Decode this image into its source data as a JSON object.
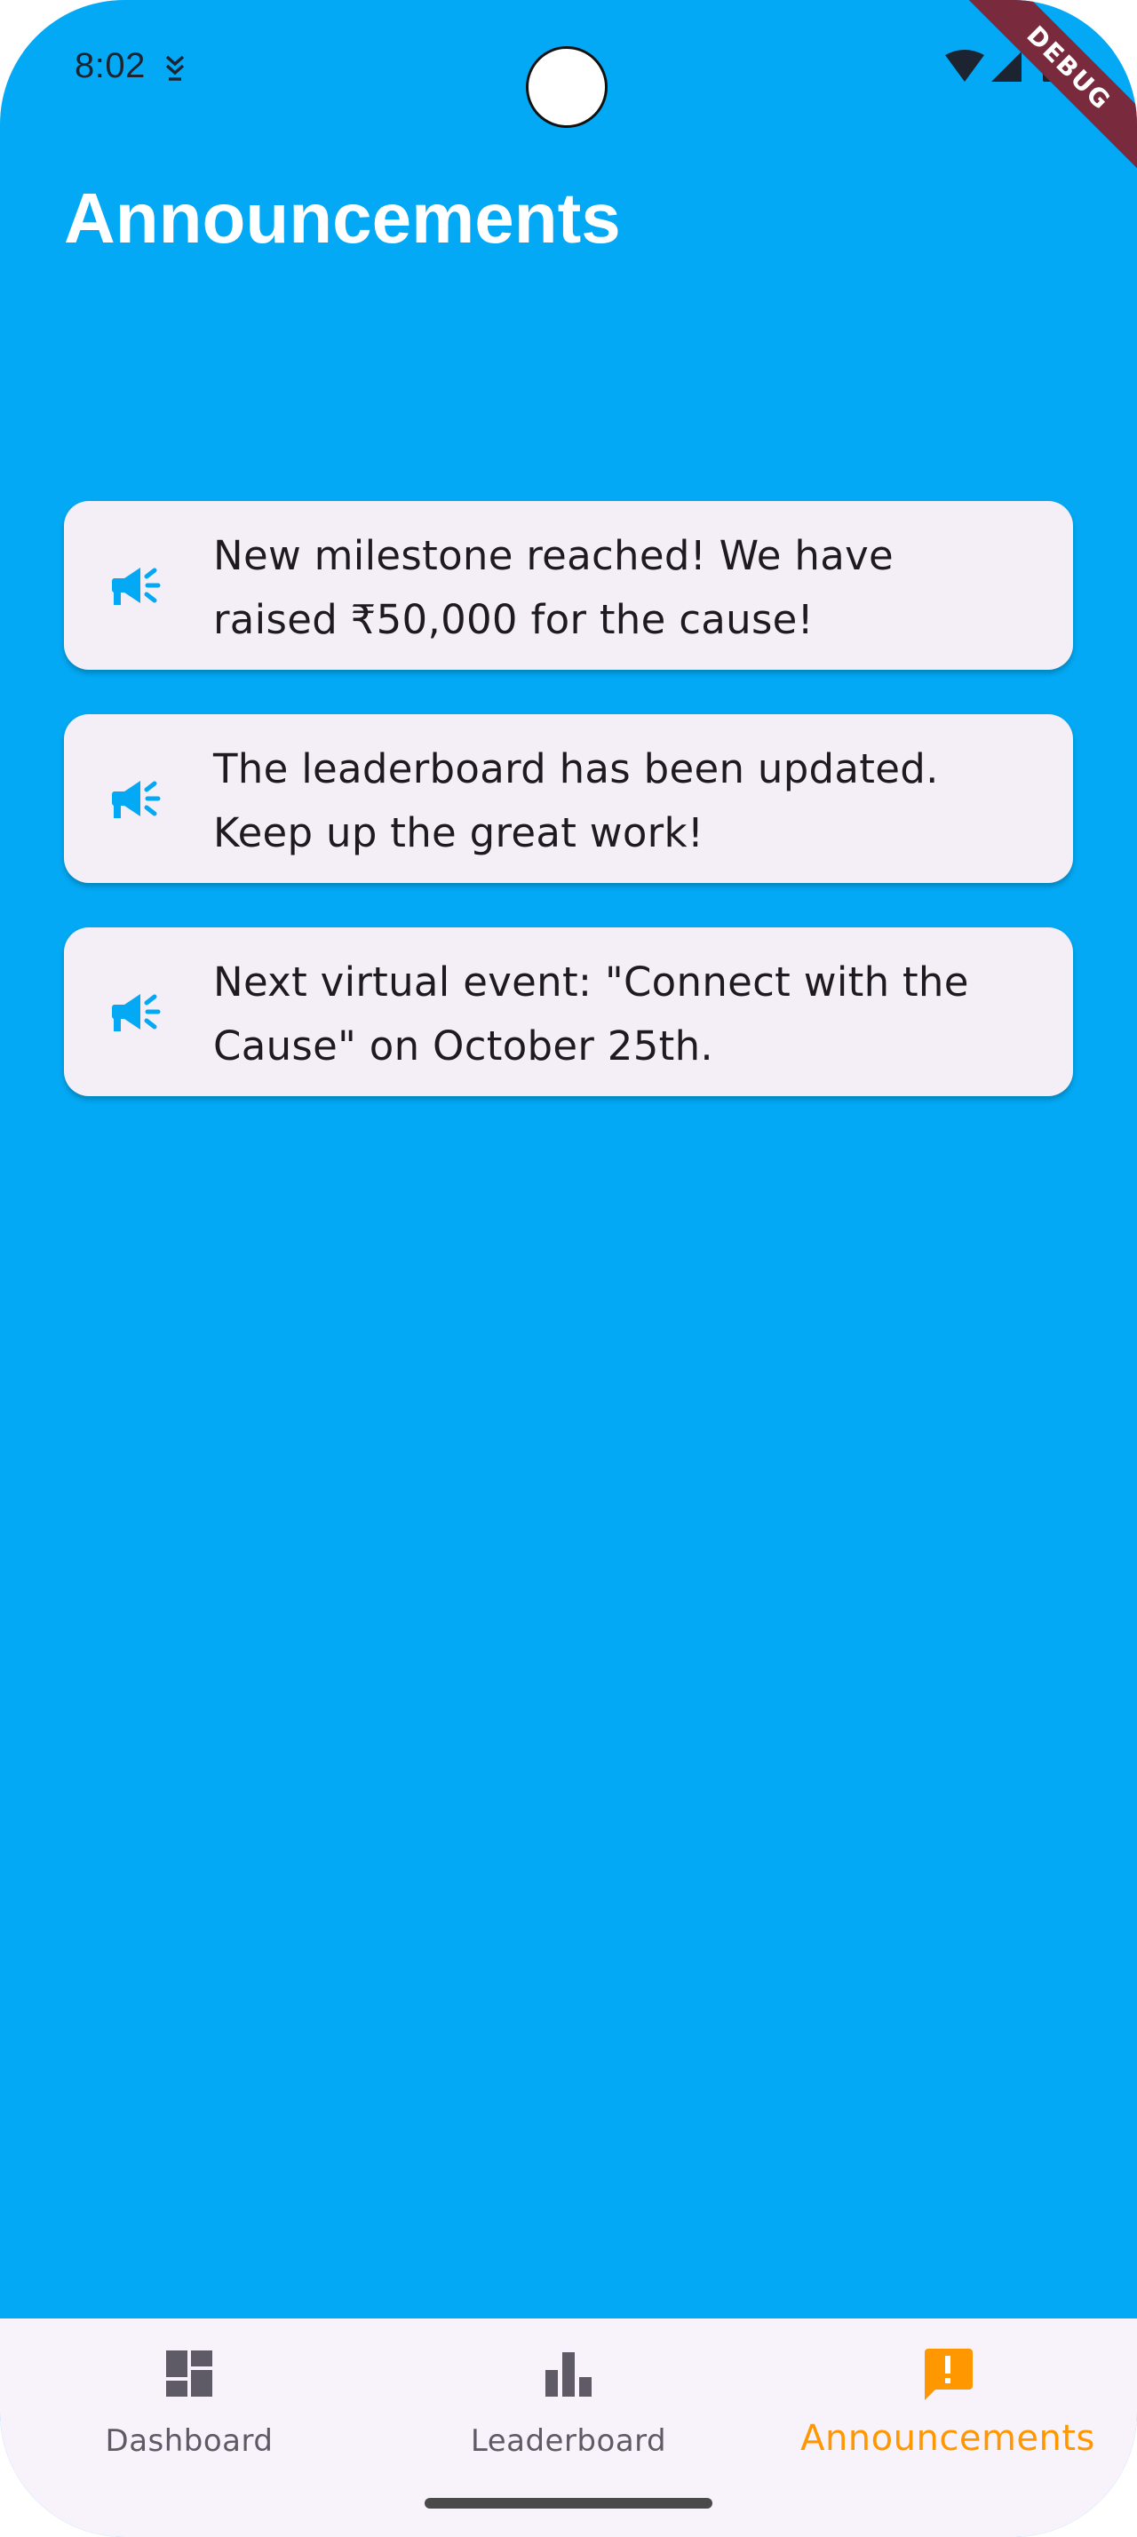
{
  "status_bar": {
    "time": "8:02",
    "debug_label": "DEBUG"
  },
  "header": {
    "title": "Announcements"
  },
  "announcements": [
    {
      "icon": "campaign-icon",
      "text": "New milestone reached! We have raised ₹50,000 for the cause!"
    },
    {
      "icon": "campaign-icon",
      "text": "The leaderboard has been updated. Keep up the great work!"
    },
    {
      "icon": "campaign-icon",
      "text": "Next virtual event: \"Connect with the Cause\" on October 25th."
    }
  ],
  "bottom_nav": {
    "items": [
      {
        "label": "Dashboard",
        "icon": "dashboard-icon",
        "active": false
      },
      {
        "label": "Leaderboard",
        "icon": "bar-chart-icon",
        "active": false
      },
      {
        "label": "Announcements",
        "icon": "announcement-icon",
        "active": true
      }
    ]
  },
  "colors": {
    "background": "#03A9F4",
    "card": "#F4EFF6",
    "card_icon": "#03A9F4",
    "nav_background": "#F8F2FA",
    "nav_inactive": "#5F5B66",
    "nav_active": "#FF9800",
    "debug_ribbon": "#7A2A3D"
  }
}
